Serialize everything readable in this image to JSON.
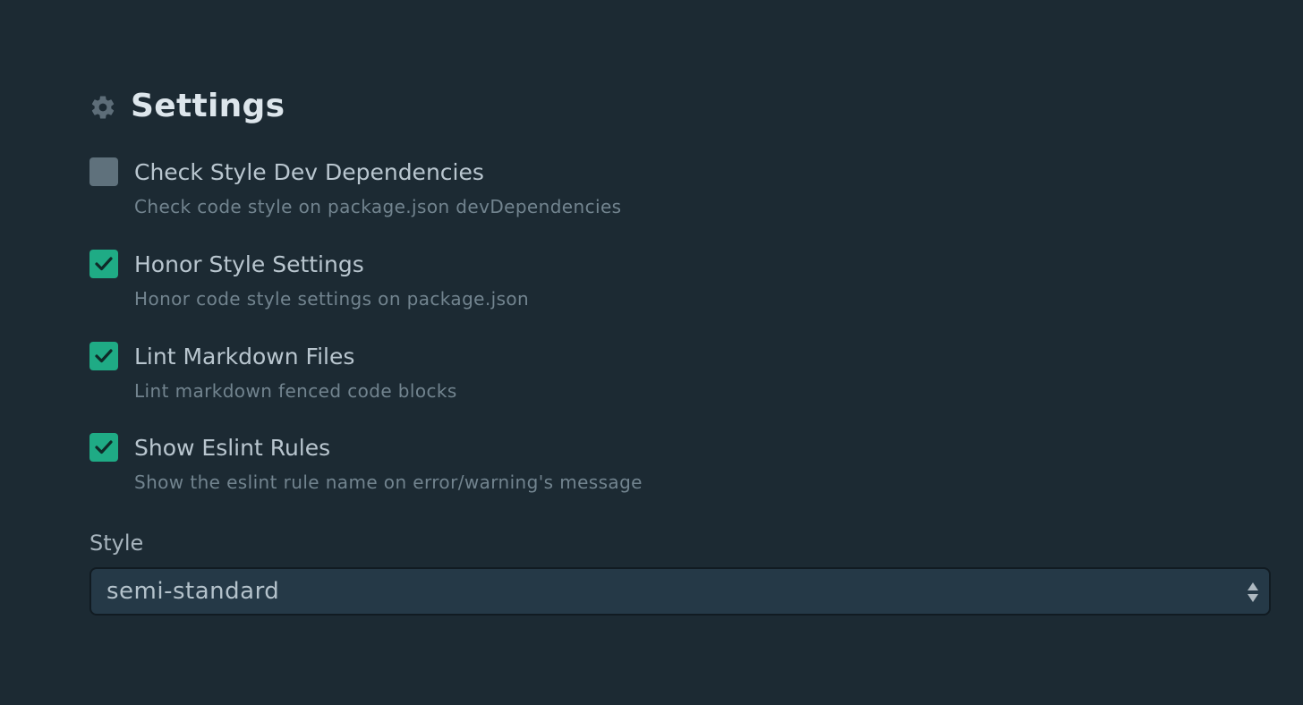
{
  "header": {
    "icon": "gear-icon",
    "title": "Settings"
  },
  "settings": [
    {
      "label": "Check Style Dev Dependencies",
      "description": "Check code style on package.json devDependencies",
      "checked": false
    },
    {
      "label": "Honor Style Settings",
      "description": "Honor code style settings on package.json",
      "checked": true
    },
    {
      "label": "Lint Markdown Files",
      "description": "Lint markdown fenced code blocks",
      "checked": true
    },
    {
      "label": "Show Eslint Rules",
      "description": "Show the eslint rule name on error/warning's message",
      "checked": true
    }
  ],
  "style": {
    "label": "Style",
    "selected": "semi-standard"
  },
  "colors": {
    "background": "#1c2a33",
    "accent_checked": "#1fab85",
    "unchecked": "#5f717c",
    "select_bg": "#253947"
  }
}
